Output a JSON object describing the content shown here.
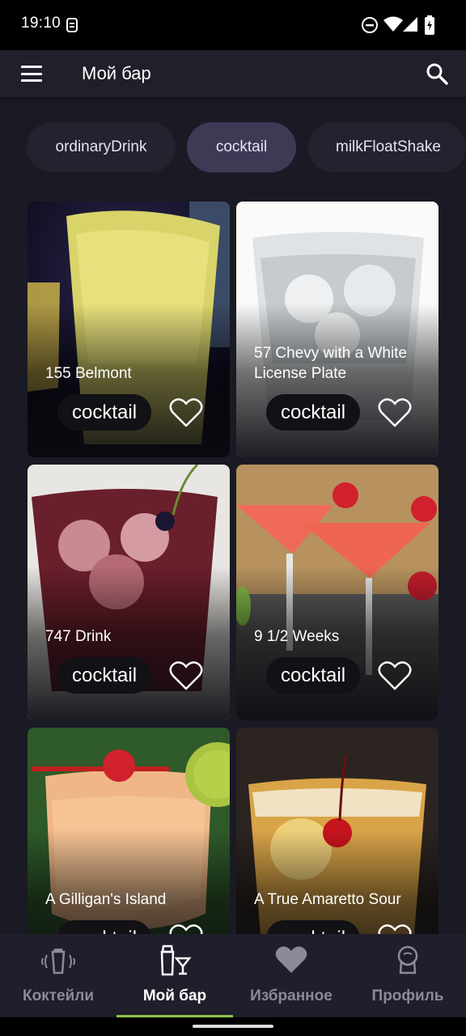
{
  "status_bar": {
    "time": "19:10"
  },
  "app_bar": {
    "title": "Мой бар"
  },
  "filters": [
    {
      "label": "ordinaryDrink",
      "selected": false
    },
    {
      "label": "cocktail",
      "selected": true
    },
    {
      "label": "milkFloatShake",
      "selected": false
    }
  ],
  "drinks": [
    {
      "name": "155 Belmont",
      "category": "cocktail",
      "favorite": false
    },
    {
      "name": "57 Chevy with a White License Plate",
      "category": "cocktail",
      "favorite": false
    },
    {
      "name": "747 Drink",
      "category": "cocktail",
      "favorite": false
    },
    {
      "name": "9 1/2 Weeks",
      "category": "cocktail",
      "favorite": false
    },
    {
      "name": "A Gilligan's Island",
      "category": "cocktail",
      "favorite": false
    },
    {
      "name": "A True Amaretto Sour",
      "category": "cocktail",
      "favorite": false
    }
  ],
  "bottom_nav": [
    {
      "label": "Коктейли",
      "icon": "shaker-icon",
      "active": false
    },
    {
      "label": "Мой бар",
      "icon": "bar-glasses-icon",
      "active": true
    },
    {
      "label": "Избранное",
      "icon": "heart-icon",
      "active": false
    },
    {
      "label": "Профиль",
      "icon": "profile-icon",
      "active": false
    }
  ],
  "colors": {
    "background": "#1a1a24",
    "selected_chip": "#3e3a56",
    "active_indicator": "#8bc34a"
  }
}
